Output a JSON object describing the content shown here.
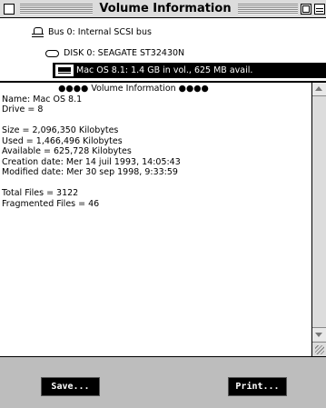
{
  "window": {
    "title": "Volume Information"
  },
  "tree": {
    "bus_label": "Bus 0: Internal SCSI bus",
    "disk_label": "DISK 0: SEAGATE ST32430N",
    "volume_label": "Mac OS 8.1: 1.4 GB in vol., 625 MB avail."
  },
  "content": {
    "header": "●●●● Volume Information ●●●●",
    "lines_top": [
      "Name: Mac OS 8.1",
      "Drive = 8"
    ],
    "lines_mid": [
      "Size = 2,096,350 Kilobytes",
      "Used = 1,466,496 Kilobytes",
      "Available = 625,728 Kilobytes",
      "Creation date: Mer 14 juil 1993, 14:05:43",
      "Modified date: Mer 30 sep 1998, 9:33:59"
    ],
    "lines_bottom": [
      "Total Files = 3122",
      "Fragmented Files = 46"
    ]
  },
  "buttons": {
    "save_label": "Save...",
    "print_label": "Print..."
  },
  "icons": {
    "close": "close-box-icon",
    "zoom": "zoom-box-icon",
    "collapse": "collapse-box-icon",
    "bus": "scsi-bus-icon",
    "disk": "disk-icon",
    "lock": "lock-icon",
    "volume": "hard-drive-icon"
  }
}
